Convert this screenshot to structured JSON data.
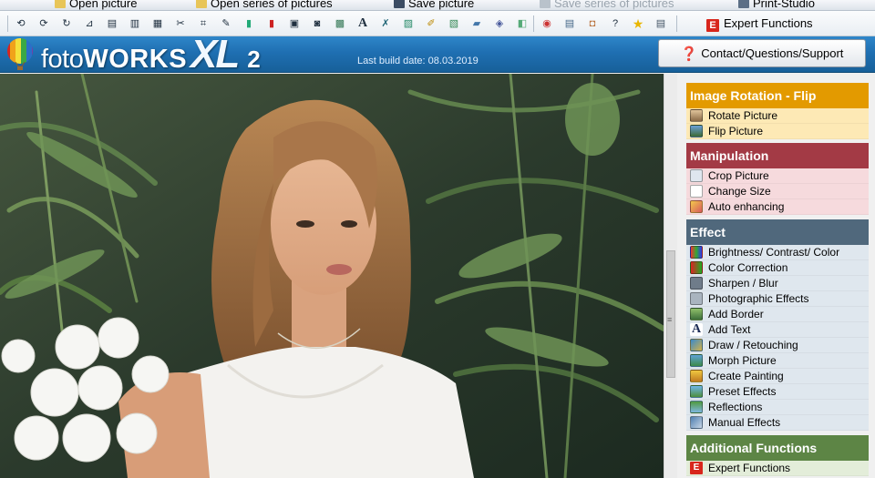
{
  "menubar": {
    "items": [
      {
        "label": "Open picture",
        "disabled": false
      },
      {
        "label": "Open series of pictures",
        "disabled": false
      },
      {
        "label": "Save picture",
        "disabled": false
      },
      {
        "label": "Save series of pictures",
        "disabled": true
      },
      {
        "label": "Print-Studio",
        "disabled": false
      }
    ]
  },
  "toolbar": {
    "icons": [
      "rotate-left-icon",
      "rotate-right-icon",
      "refresh-icon",
      "straighten-icon",
      "film-icon",
      "scanner-icon",
      "scissors-icon",
      "crop-icon",
      "wand-icon",
      "brightness-icon",
      "color-correction-icon",
      "sharpen-icon",
      "camera-icon",
      "border-icon",
      "text-icon",
      "draw-icon",
      "morph-icon",
      "painting-icon",
      "preset-icon",
      "reflection-icon",
      "manual-effects-icon",
      "red-eye-icon",
      "batch-icon",
      "package-icon",
      "hint-icon",
      "star-icon",
      "print-icon"
    ],
    "expert_label": "Expert Functions"
  },
  "header": {
    "brand_part1": "foto",
    "brand_part2": "WORKS",
    "brand_part3": "XL",
    "brand_part4": "2",
    "build_text": "Last build date: 08.03.2019",
    "support_label": "Contact/Questions/Support"
  },
  "panel": {
    "rotation": {
      "title": "Image Rotation - Flip",
      "color": "#e39a00",
      "item_bg": "#fde9b5",
      "items": [
        "Rotate Picture",
        "Flip Picture"
      ]
    },
    "manipulation": {
      "title": "Manipulation",
      "color": "#a33a45",
      "item_bg": "#f6dadd",
      "items": [
        "Crop Picture",
        "Change Size",
        "Auto enhancing"
      ]
    },
    "effect": {
      "title": "Effect",
      "color": "#50687c",
      "item_bg": "#dfe7ee",
      "items": [
        "Brightness/ Contrast/ Color",
        "Color Correction",
        "Sharpen / Blur",
        "Photographic Effects",
        "Add Border",
        "Add Text",
        "Draw / Retouching",
        "Morph Picture",
        "Create Painting",
        "Preset Effects",
        "Reflections",
        "Manual Effects"
      ]
    },
    "additional": {
      "title": "Additional Functions",
      "color": "#5d8545",
      "item_bg": "#e3edd9",
      "items": [
        "Expert Functions"
      ]
    }
  }
}
